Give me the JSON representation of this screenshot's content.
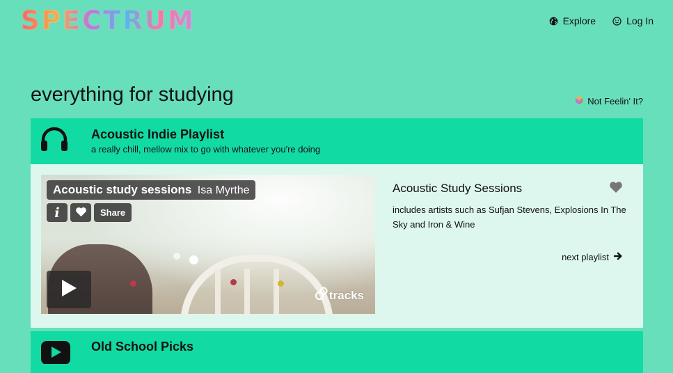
{
  "header": {
    "logo_text": "SPECTRUM",
    "nav": {
      "explore_label": "Explore",
      "login_label": "Log In"
    }
  },
  "page": {
    "title": "everything for studying",
    "not_feelin_label": "Not Feelin' It?"
  },
  "playlists": [
    {
      "title": "Acoustic Indie Playlist",
      "subtitle": "a really chill, mellow mix to go with whatever you're doing",
      "icon": "headphones-icon",
      "player": {
        "mix_title": "Acoustic study sessions",
        "artist": "Isa Myrthe",
        "info_label": "i",
        "share_label": "Share",
        "brand_label": "tracks"
      },
      "info": {
        "title": "Acoustic Study Sessions",
        "description": "includes artists such as Sufjan Stevens, Explosions In The Sky and Iron & Wine",
        "next_label": "next playlist"
      }
    },
    {
      "title": "Old School Picks",
      "icon": "play-icon"
    }
  ],
  "colors": {
    "background": "#68dfbb",
    "header_band": "#12daa3",
    "card_body": "#ddf7ee",
    "overlay": "#333333"
  }
}
